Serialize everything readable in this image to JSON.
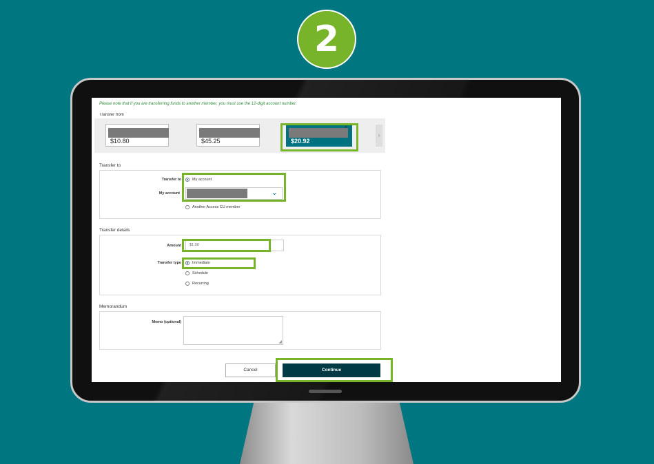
{
  "step": {
    "number": "2"
  },
  "notice": "Please note that if you are transferring funds to another member, you must use the 12-digit account number.",
  "transfer_from": {
    "label": "Transfer from",
    "accounts": [
      {
        "balance": "$10.80",
        "selected": false
      },
      {
        "balance": "$45.25",
        "selected": false
      },
      {
        "balance": "$20.92",
        "selected": true
      }
    ]
  },
  "transfer_to": {
    "section_title": "Transfer to",
    "transfer_to_label": "Transfer to",
    "option_my_account": "My account",
    "my_account_label": "My account",
    "option_other_member": "Another Access CU member"
  },
  "details": {
    "section_title": "Transfer details",
    "amount_label": "Amount",
    "amount_value": "$1.00",
    "transfer_type_label": "Transfer type",
    "options": [
      "Immediate",
      "Schedule",
      "Recurring"
    ]
  },
  "memo": {
    "section_title": "Memorandum",
    "label": "Memo (optional)"
  },
  "actions": {
    "cancel": "Cancel",
    "continue": "Continue"
  },
  "colors": {
    "background": "#007681",
    "highlight": "#78b42a",
    "selected_card": "#00727f",
    "primary_button": "#003a45",
    "notice_text": "#2e8b3a"
  }
}
